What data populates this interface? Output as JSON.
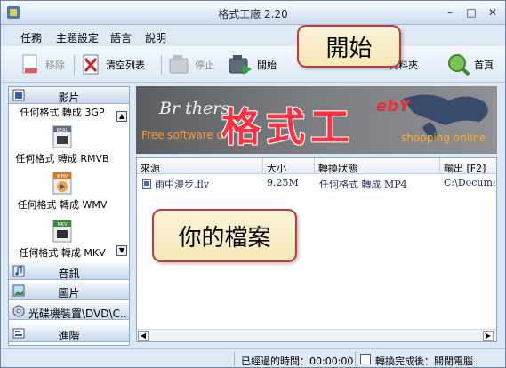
{
  "window": {
    "title": "格式工廠 2.20"
  },
  "menu": {
    "items": [
      "任務",
      "主題設定",
      "語言",
      "說明"
    ]
  },
  "toolbar": {
    "remove": "移除",
    "clear": "清空列表",
    "stop": "停止",
    "start": "開始",
    "folder": "資料夾",
    "home": "首頁"
  },
  "callouts": {
    "start": "開始",
    "file": "你的檔案"
  },
  "sidebar": {
    "video_header": "影片",
    "converters": [
      "任何格式 轉成 3GP",
      "任何格式 轉成 RMVB",
      "任何格式 轉成 WMV",
      "任何格式 轉成 MKV"
    ],
    "converter_badges": [
      "REAL",
      "WMV",
      "MKV"
    ],
    "audio_header": "音訊",
    "image_header": "圖片",
    "disc_header": "光碟機裝置\\DVD\\C...",
    "advanced_header": "進階"
  },
  "banner": {
    "brand": "Br thers",
    "free_text": "Free software d",
    "big_text": "格式工",
    "ebay": "ebY",
    "shopping": "shopping online"
  },
  "table": {
    "columns": [
      "來源",
      "大小",
      "轉換狀態",
      "輸出 [F2]"
    ],
    "rows": [
      {
        "source": "雨中漫步.flv",
        "size": "9.25M",
        "status": "任何格式 轉成 MP4",
        "output": "C:\\Documen"
      }
    ]
  },
  "status": {
    "elapsed": "已經過的時間：00:00:00",
    "after_done": "轉換完成後：關閉電腦"
  },
  "colors": {
    "accent": "#c23b3b",
    "frame": "#6b86ad",
    "banner_title": "#ff3040"
  }
}
